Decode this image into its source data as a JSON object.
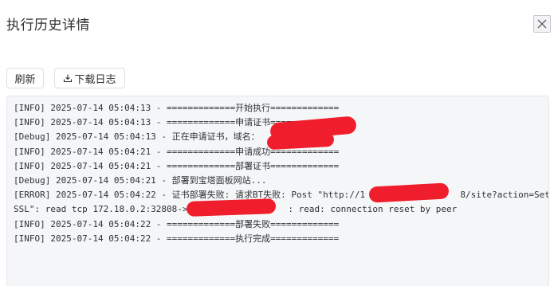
{
  "dialog": {
    "title": "执行历史详情"
  },
  "toolbar": {
    "refresh_label": "刷新",
    "download_label": "下载日志"
  },
  "log": {
    "lines": [
      "[INFO] 2025-07-14 05:04:13 - =============开始执行=============",
      "[INFO] 2025-07-14 05:04:13 - =============申请证书=============",
      "[Debug] 2025-07-14 05:04:13 - 正在申请证书，域名：",
      "[INFO] 2025-07-14 05:04:21 - =============申请成功=============",
      "[INFO] 2025-07-14 05:04:21 - =============部署证书=============",
      "[Debug] 2025-07-14 05:04:21 - 部署到宝塔面板网站...",
      "[ERROR] 2025-07-14 05:04:22 - 证书部署失败: 请求BT失败: Post \"http://1                  8/site?action=Set",
      "SSL\": read tcp 172.18.0.2:32808->                   : read: connection reset by peer",
      "[INFO] 2025-07-14 05:04:22 - =============部署失败=============",
      "[INFO] 2025-07-14 05:04:22 - =============执行完成============="
    ]
  },
  "colors": {
    "redaction": "#f01e2c",
    "log_background": "#f5f6f7",
    "text": "#303133"
  },
  "icons": {
    "close": "close-icon",
    "download": "download-icon"
  }
}
